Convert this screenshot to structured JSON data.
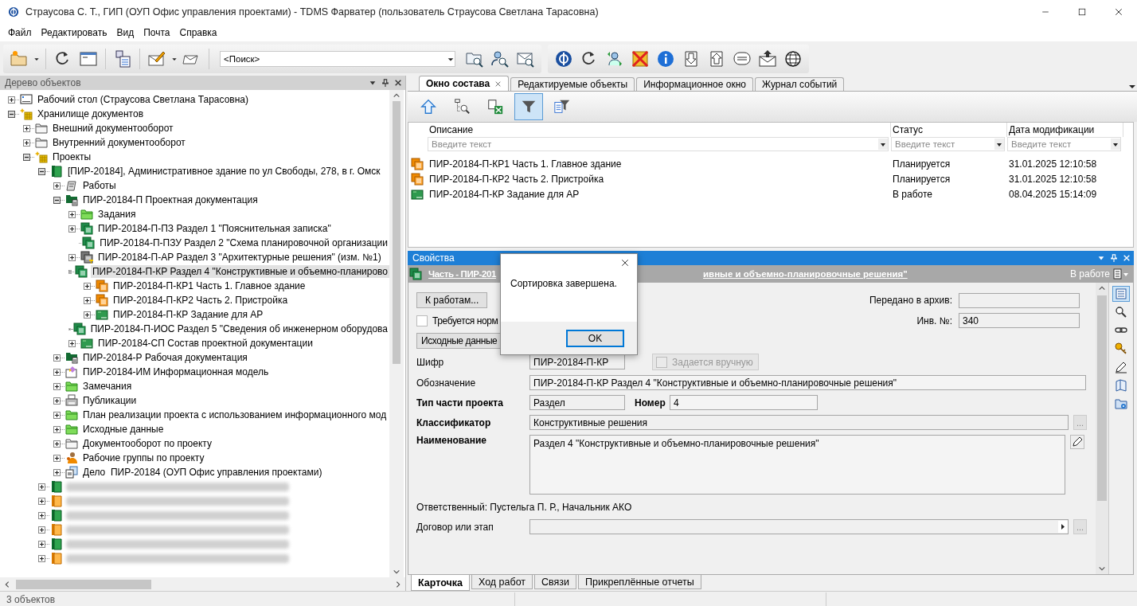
{
  "window": {
    "title": "Страусова С. Т., ГИП (ОУП Офис управления проектами) - TDMS Фарватер (пользователь Страусова Светлана Тарасовна)"
  },
  "menu": [
    "Файл",
    "Редактировать",
    "Вид",
    "Почта",
    "Справка"
  ],
  "search": {
    "value": "<Поиск>"
  },
  "tree_panel": {
    "title": "Дерево объектов",
    "active": false,
    "tree": [
      {
        "label": "Рабочий стол (Страусова Светлана Тарасовна)",
        "kind": "desktop",
        "expandable": true,
        "expanded": false,
        "selected": false
      },
      {
        "label": "Хранилище документов",
        "kind": "storage",
        "expandable": true,
        "expanded": true,
        "selected": false,
        "children": [
          {
            "label": "Внешний документооборот",
            "kind": "folder",
            "expandable": true,
            "expanded": false,
            "selected": false
          },
          {
            "label": "Внутренний документооборот",
            "kind": "folder",
            "expandable": true,
            "expanded": false,
            "selected": false
          },
          {
            "label": "Проекты",
            "kind": "storage",
            "expandable": true,
            "expanded": true,
            "selected": false,
            "children": [
              {
                "label": "[ПИР-20184], Административное здание по ул Свободы, 278, в г. Омск",
                "kind": "project-green",
                "expandable": true,
                "expanded": true,
                "selected": false,
                "children": [
                  {
                    "label": "Работы",
                    "kind": "works",
                    "expandable": true,
                    "expanded": false,
                    "selected": false
                  },
                  {
                    "label": "ПИР-20184-П Проектная документация",
                    "kind": "doc-folder",
                    "expandable": true,
                    "expanded": true,
                    "selected": false,
                    "children": [
                      {
                        "label": "Задания",
                        "kind": "folder-green",
                        "expandable": true,
                        "expanded": false,
                        "selected": false
                      },
                      {
                        "label": "ПИР-20184-П-ПЗ Раздел 1 \"Пояснительная записка\"",
                        "kind": "section-green",
                        "expandable": true,
                        "expanded": false,
                        "selected": false
                      },
                      {
                        "label": "ПИР-20184-П-ПЗУ Раздел 2 \"Схема планировочной организации",
                        "kind": "section-green",
                        "expandable": false,
                        "selected": false
                      },
                      {
                        "label": "ПИР-20184-П-АР Раздел 3 \"Архитектурные решения\" (изм. №1)",
                        "kind": "section-gray",
                        "expandable": true,
                        "expanded": false,
                        "selected": false
                      },
                      {
                        "label": "ПИР-20184-П-КР Раздел 4 \"Конструктивные и объемно-планирово",
                        "kind": "section-green",
                        "expandable": true,
                        "expanded": true,
                        "selected": true,
                        "children": [
                          {
                            "label": "ПИР-20184-П-КР1 Часть 1. Главное здание",
                            "kind": "part-orange",
                            "expandable": true,
                            "expanded": false,
                            "selected": false
                          },
                          {
                            "label": "ПИР-20184-П-КР2 Часть 2. Пристройка",
                            "kind": "part-orange",
                            "expandable": true,
                            "expanded": false,
                            "selected": false
                          },
                          {
                            "label": "ПИР-20184-П-КР Задание для АР",
                            "kind": "task-green",
                            "expandable": true,
                            "expanded": false,
                            "selected": false
                          }
                        ]
                      },
                      {
                        "label": "ПИР-20184-П-ИОС Раздел 5 \"Сведения об инженерном оборудова",
                        "kind": "section-green",
                        "expandable": true,
                        "expanded": false,
                        "selected": false
                      },
                      {
                        "label": "ПИР-20184-СП Состав проектной документации",
                        "kind": "task-green",
                        "expandable": true,
                        "expanded": false,
                        "selected": false
                      }
                    ]
                  },
                  {
                    "label": "ПИР-20184-Р Рабочая документация",
                    "kind": "doc-folder",
                    "expandable": true,
                    "expanded": false,
                    "selected": false
                  },
                  {
                    "label": "ПИР-20184-ИМ Информационная модель",
                    "kind": "model",
                    "expandable": true,
                    "expanded": false,
                    "selected": false
                  },
                  {
                    "label": "Замечания",
                    "kind": "folder-green",
                    "expandable": true,
                    "expanded": false,
                    "selected": false
                  },
                  {
                    "label": "Публикации",
                    "kind": "print",
                    "expandable": true,
                    "expanded": false,
                    "selected": false
                  },
                  {
                    "label": "План реализации проекта с использованием информационного мод",
                    "kind": "folder-green",
                    "expandable": true,
                    "expanded": false,
                    "selected": false
                  },
                  {
                    "label": "Исходные данные",
                    "kind": "folder-green",
                    "expandable": true,
                    "expanded": false,
                    "selected": false
                  },
                  {
                    "label": "Документооборот по проекту",
                    "kind": "folder",
                    "expandable": true,
                    "expanded": false,
                    "selected": false
                  },
                  {
                    "label": "Рабочие группы по проекту",
                    "kind": "team",
                    "expandable": true,
                    "expanded": false,
                    "selected": false
                  },
                  {
                    "label": "Дело  ПИР-20184 (ОУП Офис управления проектами)",
                    "kind": "case",
                    "expandable": true,
                    "expanded": false,
                    "selected": false
                  }
                ]
              },
              {
                "kind": "project-green",
                "expandable": true,
                "expanded": false,
                "selected": false,
                "redacted": true
              },
              {
                "kind": "project-orange",
                "expandable": true,
                "expanded": false,
                "selected": false,
                "redacted": true
              },
              {
                "kind": "project-green",
                "expandable": true,
                "expanded": false,
                "selected": false,
                "redacted": true
              },
              {
                "kind": "project-orange",
                "expandable": true,
                "expanded": false,
                "selected": false,
                "redacted": true
              },
              {
                "kind": "project-green",
                "expandable": true,
                "expanded": false,
                "selected": false,
                "redacted": true
              },
              {
                "kind": "project-orange",
                "expandable": true,
                "expanded": false,
                "selected": false,
                "redacted": true
              }
            ]
          }
        ]
      }
    ]
  },
  "tabs": [
    {
      "label": "Окно состава",
      "selected": true
    },
    {
      "label": "Редактируемые объекты",
      "selected": false
    },
    {
      "label": "Информационное окно",
      "selected": false
    },
    {
      "label": "Журнал событий",
      "selected": false
    }
  ],
  "composition_toolbar": [
    {
      "kind": "up",
      "selected": false
    },
    {
      "kind": "tree-search",
      "selected": false
    },
    {
      "kind": "export",
      "selected": false
    },
    {
      "kind": "filter",
      "selected": true
    },
    {
      "kind": "filter-table",
      "selected": false
    }
  ],
  "table": {
    "columns": [
      {
        "title": "Описание",
        "placeholder": "Введите текст"
      },
      {
        "title": "Статус",
        "placeholder": "Введите текст"
      },
      {
        "title": "Дата модификации",
        "placeholder": "Введите текст"
      }
    ],
    "rows": [
      {
        "kind": "part-orange",
        "description": "ПИР-20184-П-КР1 Часть 1. Главное здание",
        "status": "Планируется",
        "modified": "31.01.2025 12:10:58"
      },
      {
        "kind": "part-orange",
        "description": "ПИР-20184-П-КР2 Часть 2. Пристройка",
        "status": "Планируется",
        "modified": "31.01.2025 12:10:58"
      },
      {
        "kind": "task-green",
        "description": "ПИР-20184-П-КР Задание для АР",
        "status": "В работе",
        "modified": "08.04.2025 15:14:09"
      }
    ]
  },
  "properties": {
    "title": "Свойства",
    "active": true,
    "object_title": [
      "Часть - ПИР-201",
      "ивные и объемно-планировочные решения\""
    ],
    "object_status": "В работе",
    "to_works_button": "К работам...",
    "archive_label": "Передано в архив:",
    "norm_checkbox": {
      "label": "Требуется норм",
      "checked": false
    },
    "inv_label": "Инв. №:",
    "inv_value": "340",
    "source_button": "Исходные данные",
    "cipher": {
      "label": "Шифр",
      "value": "ПИР-20184-П-КР"
    },
    "manual_checkbox": {
      "label": "Задается вручную",
      "checked": false,
      "disabled": true
    },
    "designation": {
      "label": "Обозначение",
      "value": "ПИР-20184-П-КР Раздел 4 \"Конструктивные и объемно-планировочные решения\""
    },
    "part_type": {
      "label": "Тип части проекта",
      "value": "Раздел"
    },
    "number": {
      "label": "Номер",
      "value": "4"
    },
    "classifier": {
      "label": "Классификатор",
      "value": "Конструктивные решения",
      "button": "..."
    },
    "name": {
      "label": "Наименование",
      "value": "Раздел 4 \"Конструктивные и объемно-планировочные решения\""
    },
    "responsible": "Ответственный: Пустельга П. Р., Начальник АКО",
    "contract": {
      "label": "Договор или этап",
      "button": "..."
    },
    "side_toolbar": [
      {
        "kind": "card",
        "selected": true
      },
      {
        "kind": "search",
        "selected": false
      },
      {
        "kind": "link",
        "selected": false
      },
      {
        "kind": "key",
        "selected": false
      },
      {
        "kind": "pen",
        "selected": false
      },
      {
        "kind": "book",
        "selected": false
      },
      {
        "kind": "folder-gear",
        "selected": false
      }
    ],
    "bottom_tabs": [
      {
        "label": "Карточка",
        "selected": true
      },
      {
        "label": "Ход работ",
        "selected": false
      },
      {
        "label": "Связи",
        "selected": false
      },
      {
        "label": "Прикреплённые отчеты",
        "selected": false
      }
    ]
  },
  "dialog": {
    "message": "Сортировка завершена.",
    "ok": "OK"
  },
  "status_bar": {
    "text": "3 объектов"
  }
}
